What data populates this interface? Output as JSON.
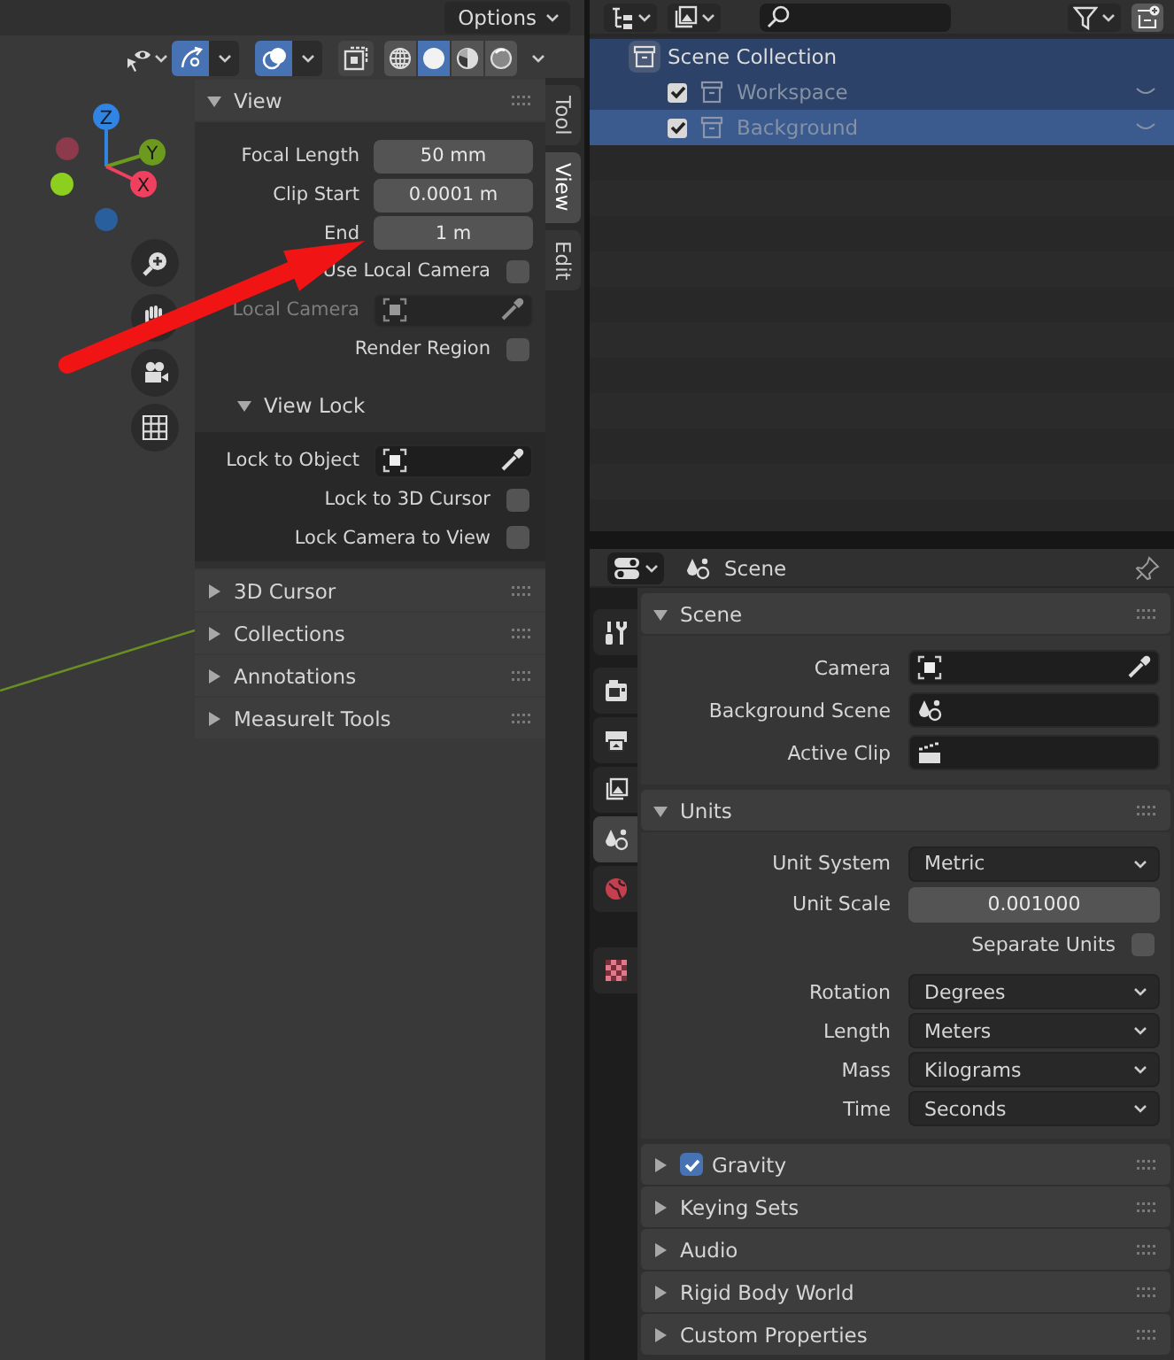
{
  "viewport": {
    "options_label": "Options",
    "toggles": [
      {
        "kind": "gizmos",
        "on": true
      },
      {
        "kind": "overlays",
        "on": true
      },
      {
        "kind": "xray",
        "on": false
      }
    ],
    "shading": [
      {
        "kind": "wireframe",
        "selected": false
      },
      {
        "kind": "solid",
        "selected": true
      },
      {
        "kind": "material",
        "selected": false
      },
      {
        "kind": "rendered",
        "selected": false
      }
    ],
    "axes": [
      {
        "label": "Z",
        "color": "#2f84e4"
      },
      {
        "label": "Y",
        "color": "#6c9a1f"
      },
      {
        "label": "X",
        "color": "#f0405f"
      }
    ],
    "sidebar": {
      "tabs": [
        {
          "label": "Tool",
          "selected": false
        },
        {
          "label": "View",
          "selected": true
        },
        {
          "label": "Edit",
          "selected": false
        }
      ],
      "panels": [
        {
          "title": "View",
          "expanded": true,
          "rows": [
            {
              "kind": "number",
              "label": "Focal Length",
              "value": "50 mm"
            },
            {
              "kind": "number",
              "label": "Clip Start",
              "value": "0.0001 m"
            },
            {
              "kind": "number",
              "label": "End",
              "value": "1 m"
            },
            {
              "kind": "checkbox",
              "label": "Use Local Camera",
              "checked": false
            },
            {
              "kind": "object",
              "label": "Local Camera",
              "disabled": true
            },
            {
              "kind": "checkbox",
              "label": "Render Region",
              "checked": false
            }
          ],
          "subpanels": [
            {
              "title": "View Lock",
              "expanded": true,
              "rows": [
                {
                  "kind": "object",
                  "label": "Lock to Object",
                  "disabled": false
                },
                {
                  "kind": "checkbox",
                  "label": "Lock to 3D Cursor",
                  "checked": false
                },
                {
                  "kind": "checkbox",
                  "label": "Lock Camera to View",
                  "checked": false
                }
              ]
            }
          ]
        },
        {
          "title": "3D Cursor",
          "expanded": false
        },
        {
          "title": "Collections",
          "expanded": false
        },
        {
          "title": "Annotations",
          "expanded": false
        },
        {
          "title": "MeasureIt Tools",
          "expanded": false
        }
      ]
    }
  },
  "outliner": {
    "tree": [
      {
        "label": "Scene Collection",
        "kind": "scene_collection",
        "selected": true,
        "active": false,
        "children": [
          {
            "label": "Workspace",
            "kind": "collection",
            "checked": true,
            "selected": true,
            "active": false
          },
          {
            "label": "Background",
            "kind": "collection",
            "checked": true,
            "selected": true,
            "active": true
          }
        ]
      }
    ]
  },
  "properties": {
    "title": "Scene",
    "tabs": [
      {
        "kind": "tool",
        "selected": false
      },
      {
        "kind": "render",
        "selected": false
      },
      {
        "kind": "output",
        "selected": false
      },
      {
        "kind": "view_layer",
        "selected": false
      },
      {
        "kind": "scene",
        "selected": true
      },
      {
        "kind": "world",
        "selected": false
      },
      {
        "kind": "texture",
        "selected": false
      }
    ],
    "panels": [
      {
        "title": "Scene",
        "expanded": true,
        "rows": [
          {
            "kind": "object",
            "label": "Camera",
            "disabled": false
          },
          {
            "kind": "scene",
            "label": "Background Scene"
          },
          {
            "kind": "clip",
            "label": "Active Clip"
          }
        ]
      },
      {
        "title": "Units",
        "expanded": true,
        "rows": [
          {
            "kind": "menu",
            "label": "Unit System",
            "value": "Metric"
          },
          {
            "kind": "number",
            "label": "Unit Scale",
            "value": "0.001000"
          },
          {
            "kind": "checkbox",
            "label": "Separate Units",
            "checked": false
          },
          {
            "kind": "menu",
            "label": "Rotation",
            "value": "Degrees"
          },
          {
            "kind": "menu",
            "label": "Length",
            "value": "Meters"
          },
          {
            "kind": "menu",
            "label": "Mass",
            "value": "Kilograms"
          },
          {
            "kind": "menu",
            "label": "Time",
            "value": "Seconds"
          }
        ]
      },
      {
        "title": "Gravity",
        "expanded": false,
        "checked": true
      },
      {
        "title": "Keying Sets",
        "expanded": false
      },
      {
        "title": "Audio",
        "expanded": false
      },
      {
        "title": "Rigid Body World",
        "expanded": false
      },
      {
        "title": "Custom Properties",
        "expanded": false
      }
    ]
  }
}
